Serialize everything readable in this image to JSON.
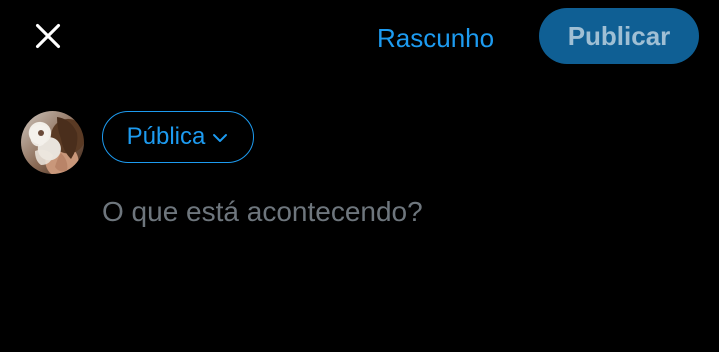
{
  "header": {
    "close_icon": "close-icon",
    "draft_label": "Rascunho",
    "publish_label": "Publicar"
  },
  "composer": {
    "avatar_icon": "user-avatar",
    "audience_label": "Pública",
    "audience_chevron_icon": "chevron-down-icon",
    "input_value": "",
    "input_placeholder": "O que está acontecendo?"
  },
  "colors": {
    "background": "#000000",
    "accent": "#1d9bf0",
    "publish_bg": "#0f5f94",
    "placeholder": "#6e767d"
  }
}
